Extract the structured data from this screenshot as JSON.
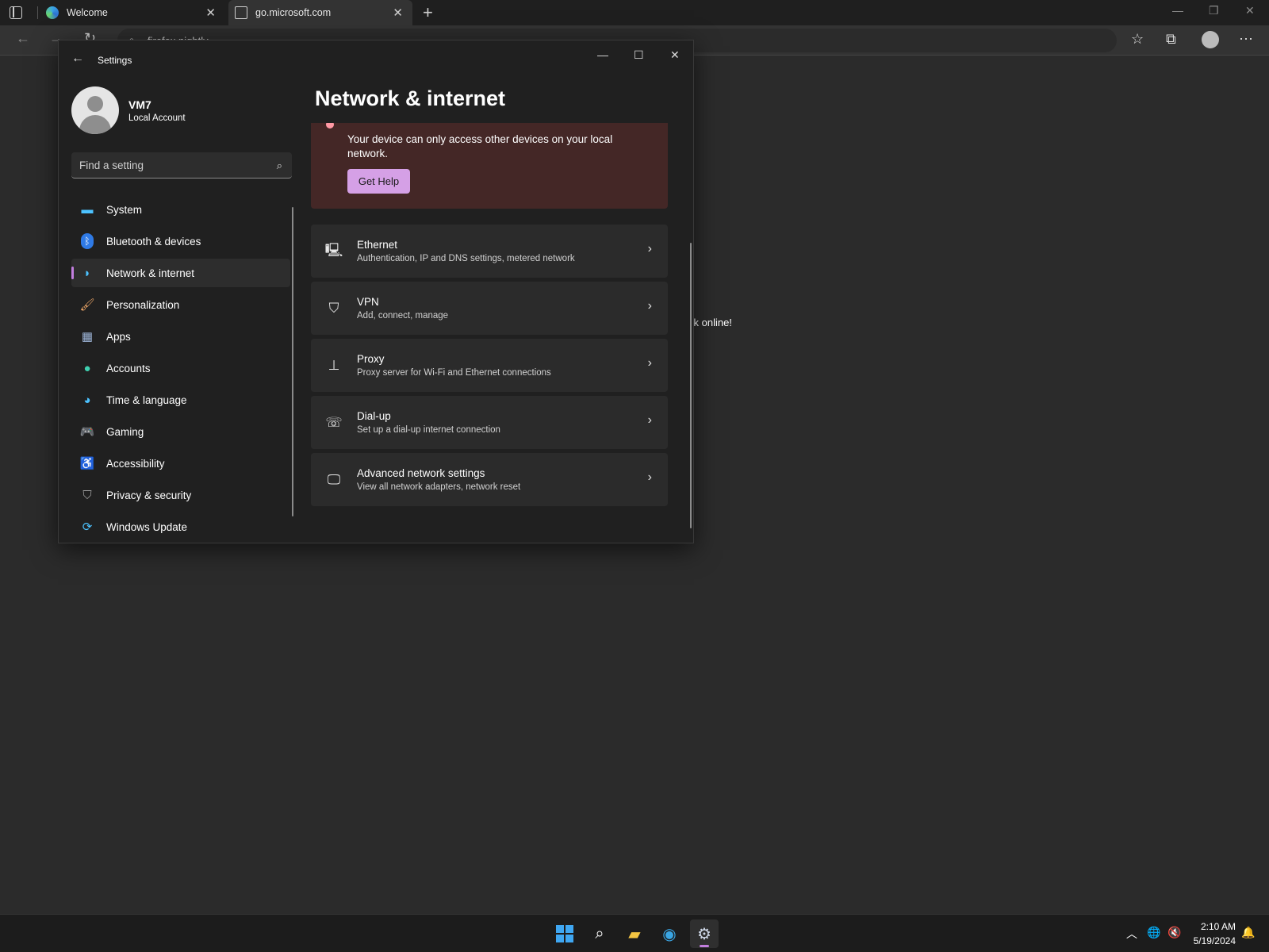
{
  "browser": {
    "tabs": [
      {
        "label": "Welcome"
      },
      {
        "label": "go.microsoft.com"
      }
    ],
    "address": "firefox nightly",
    "page_fragment": "ck online!"
  },
  "settings": {
    "app_title": "Settings",
    "user": {
      "name": "VM7",
      "account_type": "Local Account"
    },
    "search_placeholder": "Find a setting",
    "nav": [
      {
        "label": "System",
        "icon": "monitor-icon"
      },
      {
        "label": "Bluetooth & devices",
        "icon": "bluetooth-icon"
      },
      {
        "label": "Network & internet",
        "icon": "wifi-icon",
        "active": true
      },
      {
        "label": "Personalization",
        "icon": "brush-icon"
      },
      {
        "label": "Apps",
        "icon": "apps-icon"
      },
      {
        "label": "Accounts",
        "icon": "person-icon"
      },
      {
        "label": "Time & language",
        "icon": "globe-clock-icon"
      },
      {
        "label": "Gaming",
        "icon": "gamepad-icon"
      },
      {
        "label": "Accessibility",
        "icon": "accessibility-icon"
      },
      {
        "label": "Privacy & security",
        "icon": "shield-icon"
      },
      {
        "label": "Windows Update",
        "icon": "update-icon"
      }
    ],
    "page_title": "Network & internet",
    "alert": {
      "message": "Your device can only access other devices on your local network.",
      "button": "Get Help"
    },
    "rows": [
      {
        "title": "Ethernet",
        "subtitle": "Authentication, IP and DNS settings, metered network",
        "icon": "ethernet-icon"
      },
      {
        "title": "VPN",
        "subtitle": "Add, connect, manage",
        "icon": "vpn-shield-icon"
      },
      {
        "title": "Proxy",
        "subtitle": "Proxy server for Wi-Fi and Ethernet connections",
        "icon": "proxy-icon"
      },
      {
        "title": "Dial-up",
        "subtitle": "Set up a dial-up internet connection",
        "icon": "dialup-icon"
      },
      {
        "title": "Advanced network settings",
        "subtitle": "View all network adapters, network reset",
        "icon": "network-pc-icon"
      }
    ]
  },
  "taskbar": {
    "time": "2:10 AM",
    "date": "5/19/2024"
  },
  "colors": {
    "accent": "#c27ede",
    "alert_bg": "#442726",
    "button_bg": "#d5a0e6"
  }
}
